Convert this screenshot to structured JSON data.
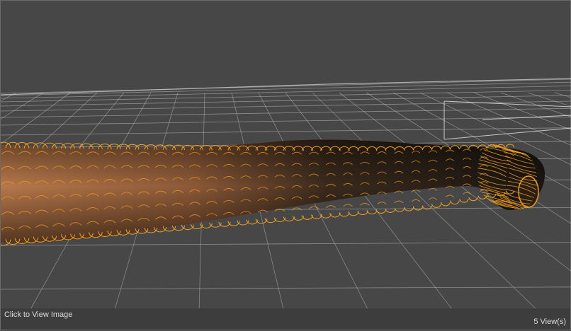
{
  "viewport": {
    "name": "3D viewport",
    "background_color": "#474747",
    "grid_color": "#c8c8c8",
    "wire_color": "#f0a020",
    "worm_colors": [
      "#a86a40",
      "#5a3a22",
      "#1d1712"
    ]
  },
  "status": {
    "click_label": "Click to View Image",
    "views_label": "5 View(s)"
  }
}
